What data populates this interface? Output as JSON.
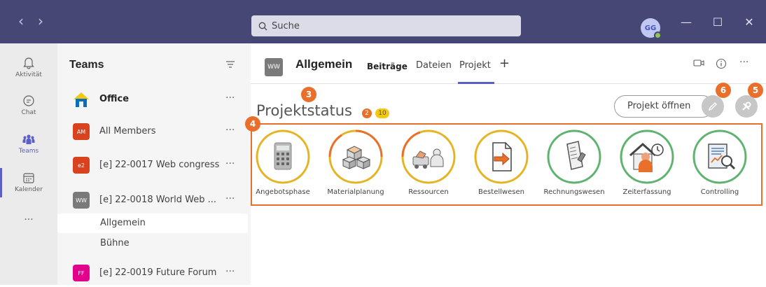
{
  "titlebar": {
    "back_glyph": "‹",
    "forward_glyph": "›",
    "search_placeholder": "Suche",
    "avatar_initials": "GG",
    "minimize": "—",
    "maximize": "☐",
    "close": "✕"
  },
  "rail": {
    "items": [
      {
        "label": "Aktivität",
        "icon": "bell-icon"
      },
      {
        "label": "Chat",
        "icon": "chat-icon"
      },
      {
        "label": "Teams",
        "icon": "teams-icon"
      },
      {
        "label": "Kalender",
        "icon": "calendar-icon"
      }
    ],
    "more": "···"
  },
  "sidebar": {
    "title": "Teams",
    "teams": [
      {
        "name": "Office",
        "logo": "",
        "more": "···"
      },
      {
        "name": "All Members",
        "logo": "AM",
        "more": "···"
      },
      {
        "name": "[e] 22-0017 Web congress",
        "logo": "e2",
        "more": "···"
      },
      {
        "name": "[e] 22-0018 World Web ...",
        "logo": "WW",
        "more": "···"
      },
      {
        "name": "[e] 22-0019 Future Forum",
        "logo": "FF",
        "more": "···"
      }
    ],
    "channels": [
      "Allgemein",
      "Bühne"
    ]
  },
  "header": {
    "logo": "WW",
    "channel": "Allgemein",
    "tabs": [
      "Beiträge",
      "Dateien",
      "Projekt"
    ],
    "add_tab": "+",
    "more": "···"
  },
  "content": {
    "title": "Projektstatus",
    "badge_red": "2",
    "badge_yellow": "10",
    "open_button": "Projekt öffnen",
    "markers": [
      "3",
      "4",
      "5",
      "6"
    ],
    "phases": [
      {
        "label": "Angebotsphase",
        "ring": "#e6b422"
      },
      {
        "label": "Materialplanung",
        "ring": "#e8702a"
      },
      {
        "label": "Ressourcen",
        "ring": "#e8702a"
      },
      {
        "label": "Bestellwesen",
        "ring": "#e6b422"
      },
      {
        "label": "Rechnungswesen",
        "ring": "#5fb36e"
      },
      {
        "label": "Zeiterfassung",
        "ring": "#5fb36e"
      },
      {
        "label": "Controlling",
        "ring": "#5fb36e"
      }
    ]
  },
  "colors": {
    "titlebar": "#464775",
    "accent": "#5b5fc7",
    "highlight": "#e8702a"
  }
}
